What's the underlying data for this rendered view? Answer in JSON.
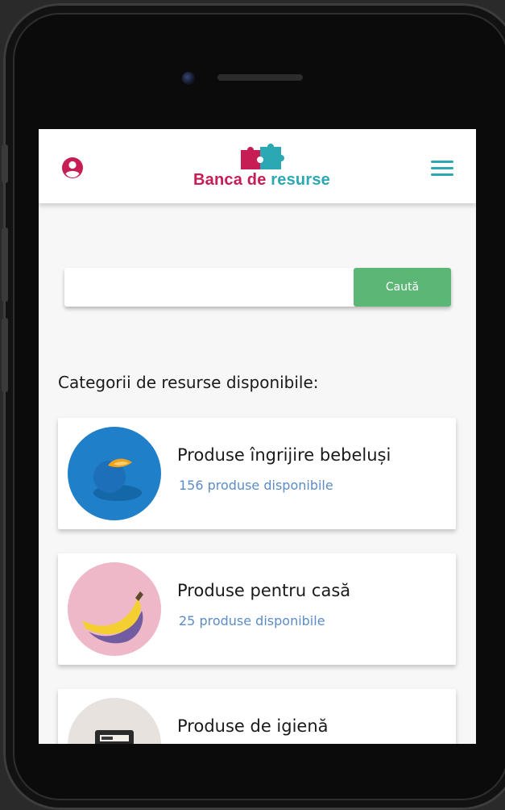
{
  "app": {
    "logo_word1": "Banca de",
    "logo_word2": "resurse",
    "brand_colors": {
      "primary": "#c61e54",
      "secondary": "#2ba8b4",
      "button": "#5cb777",
      "link": "#5b8cc7"
    }
  },
  "header": {
    "user_icon": "user-circle-icon",
    "menu_icon": "hamburger-menu-icon"
  },
  "search": {
    "value": "",
    "placeholder": "",
    "button_label": "Caută"
  },
  "categories": {
    "title": "Categorii de resurse disponibile:",
    "items": [
      {
        "name": "Produse îngrijire bebeluși",
        "count_label": "156 produse disponibile",
        "image_icon": "orange-fruit-icon"
      },
      {
        "name": "Produse pentru casă",
        "count_label": "25 produse disponibile",
        "image_icon": "banana-icon"
      },
      {
        "name": "Produse de igienă",
        "count_label": "",
        "image_icon": "product-box-icon"
      }
    ]
  }
}
